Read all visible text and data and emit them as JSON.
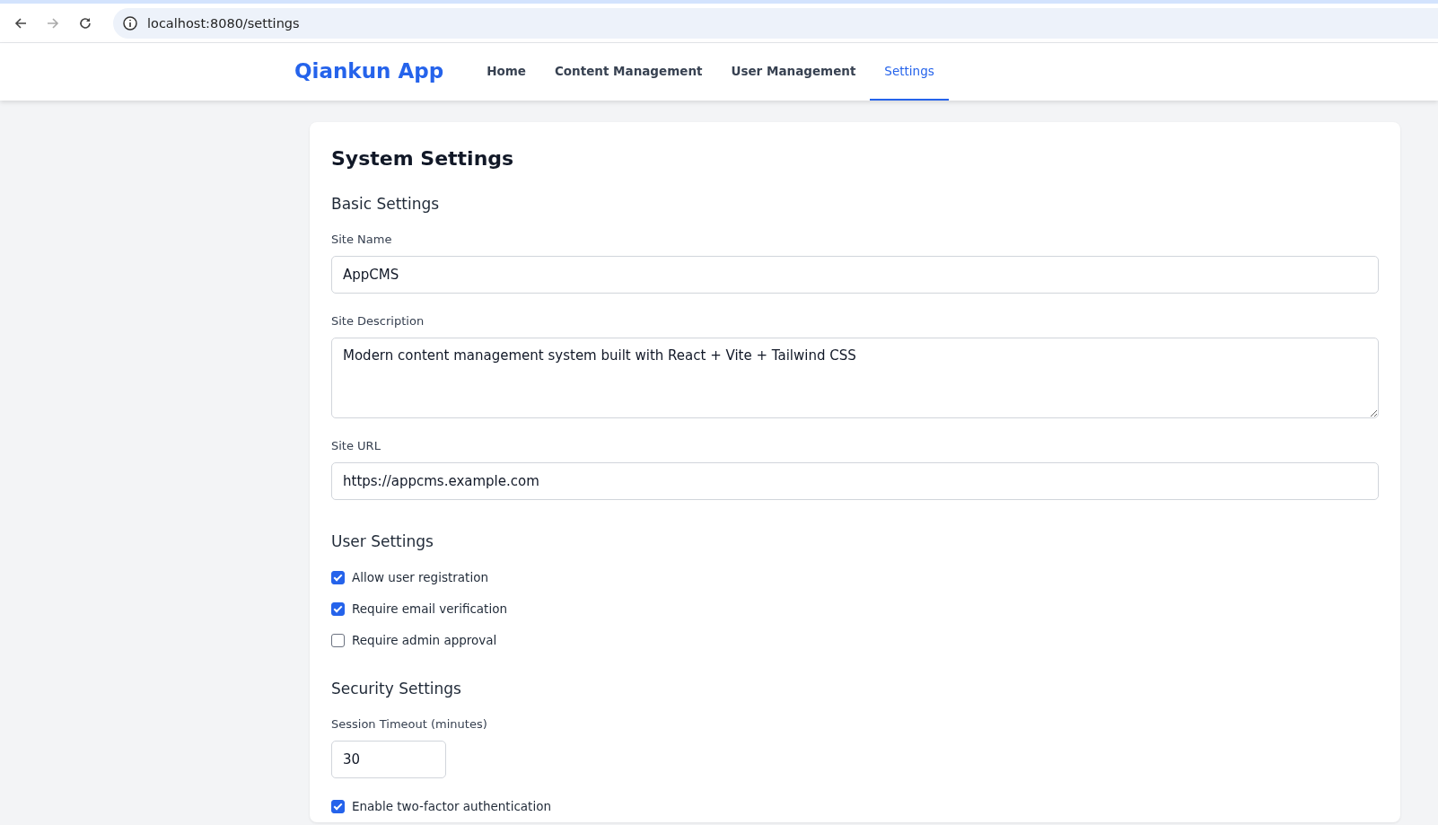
{
  "browser": {
    "url": "localhost:8080/settings"
  },
  "nav": {
    "brand": "Qiankun App",
    "tabs": [
      {
        "label": "Home",
        "selected": false
      },
      {
        "label": "Content Management",
        "selected": false
      },
      {
        "label": "User Management",
        "selected": false
      },
      {
        "label": "Settings",
        "selected": true
      }
    ]
  },
  "page": {
    "title": "System Settings",
    "sections": [
      {
        "heading": "Basic Settings",
        "fields": [
          {
            "kind": "text",
            "label": "Site Name",
            "value": "AppCMS"
          },
          {
            "kind": "textarea",
            "label": "Site Description",
            "value": "Modern content management system built with React + Vite + Tailwind CSS"
          },
          {
            "kind": "text",
            "label": "Site URL",
            "value": "https://appcms.example.com"
          }
        ]
      },
      {
        "heading": "User Settings",
        "fields": [
          {
            "kind": "checkbox",
            "label": "Allow user registration",
            "checked": true
          },
          {
            "kind": "checkbox",
            "label": "Require email verification",
            "checked": true
          },
          {
            "kind": "checkbox",
            "label": "Require admin approval",
            "checked": false
          }
        ]
      },
      {
        "heading": "Security Settings",
        "fields": [
          {
            "kind": "number",
            "label": "Session Timeout (minutes)",
            "value": "30"
          },
          {
            "kind": "checkbox",
            "label": "Enable two-factor authentication",
            "checked": true
          }
        ]
      }
    ]
  }
}
